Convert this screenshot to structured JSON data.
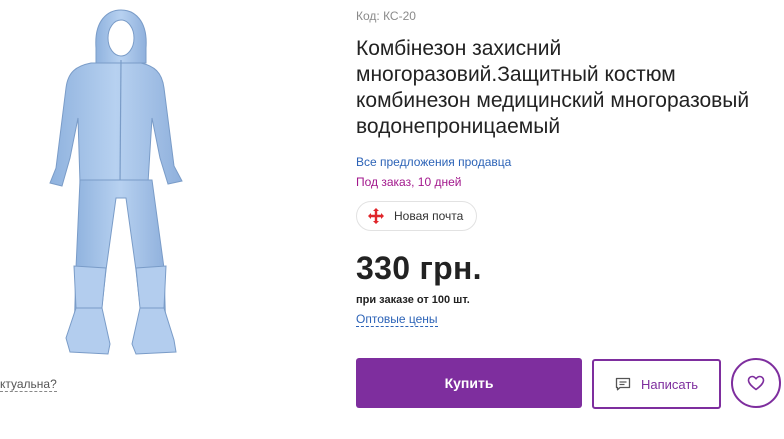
{
  "gallery": {
    "relevance_link": "ктуальна?"
  },
  "product": {
    "code": "Код: КС-20",
    "title": "Комбінезон захисний многоразовий.Защитный костюм комбинезон медицинский многоразовый водонепроницаемый",
    "seller_link": "Все предложения продавца",
    "availability": "Под заказ, 10 дней",
    "delivery": "Новая почта",
    "price": "330 грн.",
    "min_order": "при заказе от 100 шт.",
    "wholesale_link": "Оптовые цены"
  },
  "actions": {
    "buy_label": "Купить",
    "write_label": "Написать"
  },
  "colors": {
    "accent": "#7e2e9e",
    "link": "#2c63b7",
    "availability": "#a2178c",
    "nova_poshta": "#e0262b",
    "suit": "#a9c6ea"
  },
  "icons": {
    "delivery": "nova-poshta-icon",
    "message": "message-icon",
    "favorite": "heart-icon"
  }
}
